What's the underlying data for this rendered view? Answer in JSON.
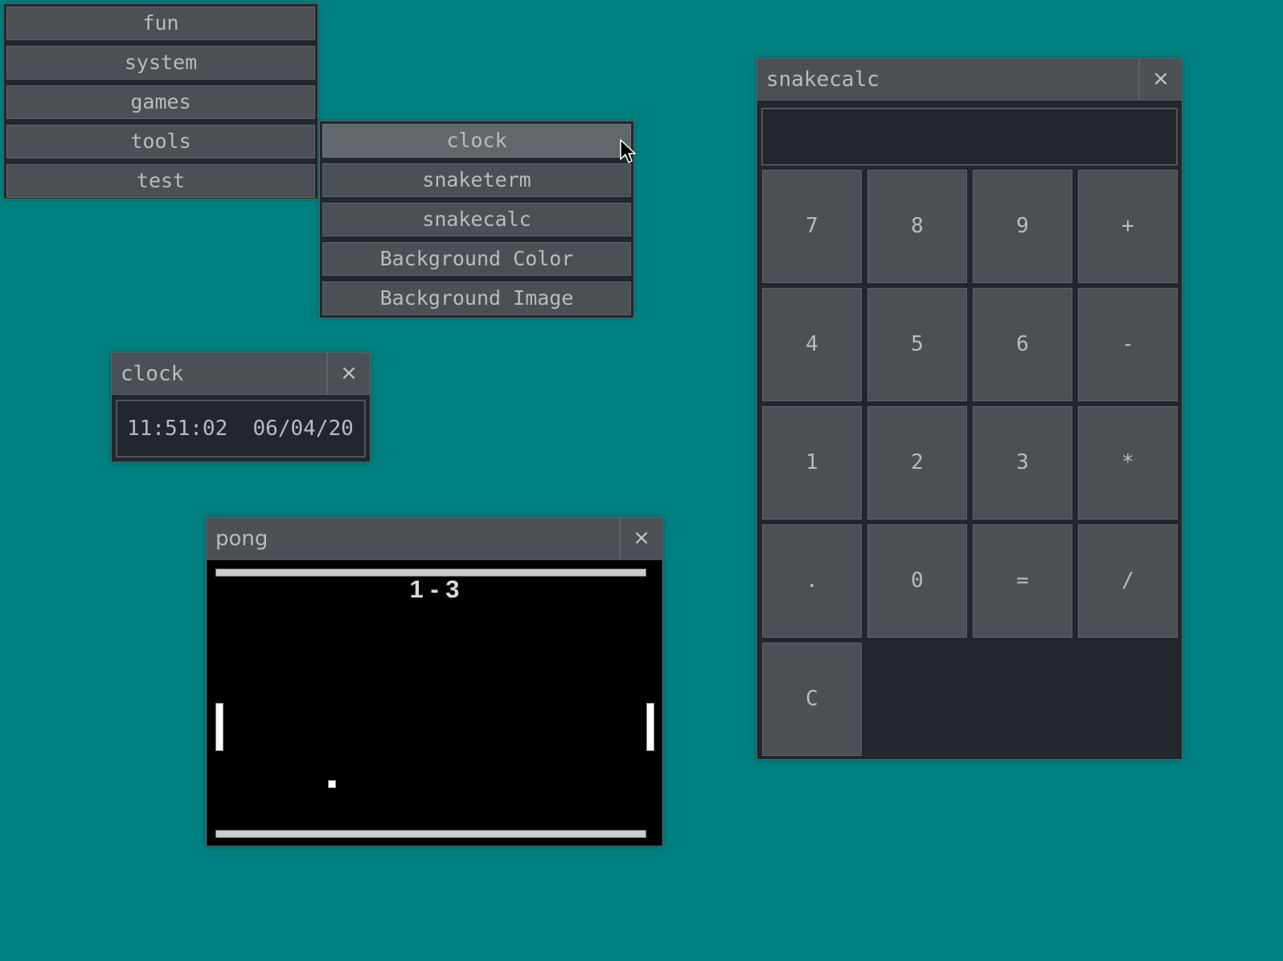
{
  "desktop": {
    "background_color": "#008080"
  },
  "main_menu": {
    "items": [
      {
        "label": "fun"
      },
      {
        "label": "system"
      },
      {
        "label": "games"
      },
      {
        "label": "tools"
      },
      {
        "label": "test"
      }
    ]
  },
  "tools_submenu": {
    "active_item": "clock",
    "items": [
      {
        "label": "clock"
      },
      {
        "label": "snaketerm"
      },
      {
        "label": "snakecalc"
      },
      {
        "label": "Background Color"
      },
      {
        "label": "Background Image"
      }
    ]
  },
  "clock_window": {
    "title": "clock",
    "close_label": "×",
    "display": "11:51:02  06/04/20"
  },
  "pong_window": {
    "title": "pong",
    "close_label": "×",
    "score": "1 - 3",
    "score_left": 1,
    "score_right": 3
  },
  "calc_window": {
    "title": "snakecalc",
    "close_label": "×",
    "display_value": "",
    "buttons": [
      {
        "label": "7"
      },
      {
        "label": "8"
      },
      {
        "label": "9"
      },
      {
        "label": "+"
      },
      {
        "label": "4"
      },
      {
        "label": "5"
      },
      {
        "label": "6"
      },
      {
        "label": "-"
      },
      {
        "label": "1"
      },
      {
        "label": "2"
      },
      {
        "label": "3"
      },
      {
        "label": "*"
      },
      {
        "label": "."
      },
      {
        "label": "0"
      },
      {
        "label": "="
      },
      {
        "label": "/"
      },
      {
        "label": "C"
      }
    ]
  }
}
